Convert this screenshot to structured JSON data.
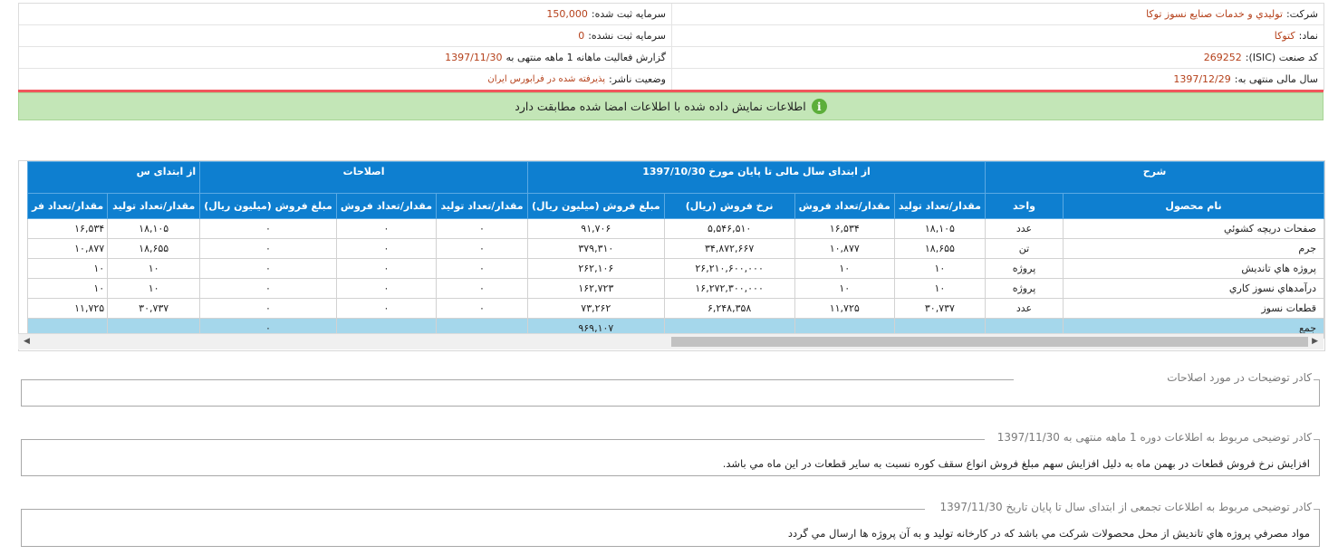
{
  "info": {
    "rows": [
      {
        "right_label": "شرکت:",
        "right_value": "توليدي و خدمات صنايع نسوز توكا",
        "left_label": "سرمایه ثبت شده:",
        "left_value": "150,000"
      },
      {
        "right_label": "نماد:",
        "right_value": "كتوكا",
        "left_label": "سرمایه ثبت نشده:",
        "left_value": "0"
      },
      {
        "right_label": "کد صنعت (ISIC):",
        "right_value": "269252",
        "left_label": "گزارش فعالیت ماهانه 1 ماهه منتهی به",
        "left_value": "1397/11/30"
      },
      {
        "right_label": "سال مالی منتهی به:",
        "right_value": "1397/12/29",
        "left_label": "وضعیت ناشر:",
        "left_value": "پذیرفته شده در فرابورس ایران"
      }
    ]
  },
  "banner": {
    "icon": "info-icon",
    "text": "اطلاعات نمایش داده شده با اطلاعات امضا شده مطابقت دارد",
    "icon_glyph": "i"
  },
  "grid": {
    "group_headers": [
      "شرح",
      "از ابتدای سال مالی تا پایان مورخ 1397/10/30",
      "اصلاحات",
      "از ابتدای س"
    ],
    "columns": [
      "نام محصول",
      "واحد",
      "مقدار/تعداد تولید",
      "مقدار/تعداد فروش",
      "نرخ فروش (ریال)",
      "مبلغ فروش (میلیون ریال)",
      "مقدار/تعداد تولید",
      "مقدار/تعداد فروش",
      "مبلغ فروش (میلیون ریال)",
      "مقدار/تعداد تولید",
      "مقدار/تعداد فر"
    ],
    "rows": [
      [
        "صفحات دريچه كشوئي",
        "عدد",
        "۱۸,۱۰۵",
        "۱۶,۵۳۴",
        "۵,۵۴۶,۵۱۰",
        "۹۱,۷۰۶",
        "۰",
        "۰",
        "۰",
        "۱۸,۱۰۵",
        "۱۶,۵۳۴"
      ],
      [
        "جرم",
        "تن",
        "۱۸,۶۵۵",
        "۱۰,۸۷۷",
        "۳۴,۸۷۲,۶۶۷",
        "۳۷۹,۳۱۰",
        "۰",
        "۰",
        "۰",
        "۱۸,۶۵۵",
        "۱۰,۸۷۷"
      ],
      [
        "پروژه هاي تانديش",
        "پروژه",
        "۱۰",
        "۱۰",
        "۲۶,۲۱۰,۶۰۰,۰۰۰",
        "۲۶۲,۱۰۶",
        "۰",
        "۰",
        "۰",
        "۱۰",
        "۱۰"
      ],
      [
        "درآمدهاي نسوز كاري",
        "پروژه",
        "۱۰",
        "۱۰",
        "۱۶,۲۷۲,۳۰۰,۰۰۰",
        "۱۶۲,۷۲۳",
        "۰",
        "۰",
        "۰",
        "۱۰",
        "۱۰"
      ],
      [
        "قطعات نسوز",
        "عدد",
        "۳۰,۷۳۷",
        "۱۱,۷۲۵",
        "۶,۲۴۸,۳۵۸",
        "۷۳,۲۶۲",
        "۰",
        "۰",
        "۰",
        "۳۰,۷۳۷",
        "۱۱,۷۲۵"
      ]
    ],
    "total": {
      "label": "جمع",
      "sales_amount": "۹۶۹,۱۰۷",
      "correction_amount": "۰"
    }
  },
  "boxes": [
    {
      "legend": "کادر توضیحات در مورد اصلاحات",
      "text": ""
    },
    {
      "legend": "کادر توضیحی مربوط به اطلاعات دوره 1 ماهه منتهی به 1397/11/30",
      "text": "افزايش نرخ فروش قطعات در بهمن ماه به دليل افزايش سهم مبلغ فروش انواع سقف كوره نسبت به ساير قطعات در اين ماه مي باشد."
    },
    {
      "legend": "کادر توضیحی مربوط به اطلاعات تجمعی از ابتدای سال تا پایان تاریخ 1397/11/30",
      "text": "مواد مصرفي پروژه هاي تانديش از محل محصولات شركت مي باشد كه در كارخانه توليد و به آن پروژه ها ارسال مي گردد"
    }
  ]
}
